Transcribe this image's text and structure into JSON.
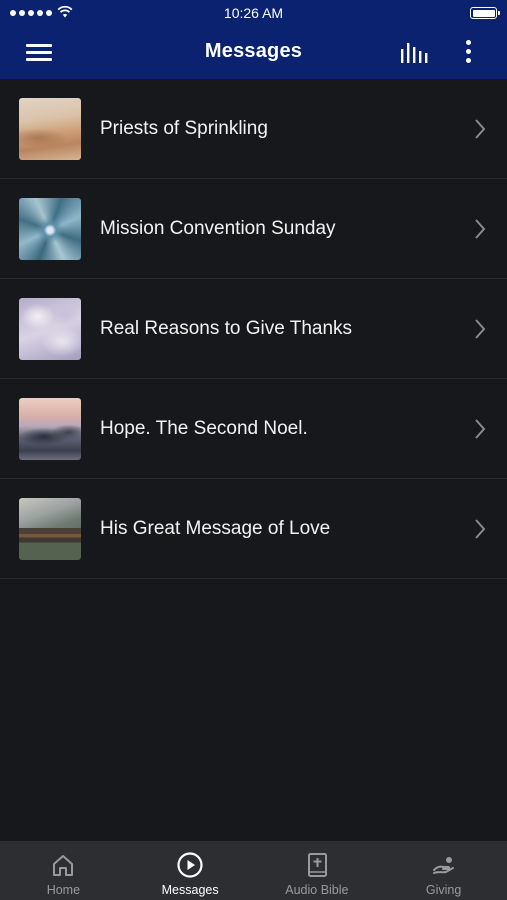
{
  "status_bar": {
    "time": "10:26 AM"
  },
  "header": {
    "title": "Messages"
  },
  "messages": [
    {
      "title": "Priests of Sprinkling",
      "thumb": "desert-dunes"
    },
    {
      "title": "Mission Convention Sunday",
      "thumb": "agave-plant"
    },
    {
      "title": "Real Reasons to Give Thanks",
      "thumb": "clouds"
    },
    {
      "title": "Hope. The Second Noel.",
      "thumb": "misty-mountains"
    },
    {
      "title": "His Great Message of Love",
      "thumb": "mountain-lake-cabin"
    }
  ],
  "tabs": [
    {
      "label": "Home",
      "icon": "home-icon",
      "active": false
    },
    {
      "label": "Messages",
      "icon": "play-circle-icon",
      "active": true
    },
    {
      "label": "Audio Bible",
      "icon": "bible-icon",
      "active": false
    },
    {
      "label": "Giving",
      "icon": "giving-hand-icon",
      "active": false
    }
  ],
  "colors": {
    "header_bg": "#0a2270",
    "list_bg": "#17181b",
    "tab_bar_bg": "#2d2e31",
    "tab_inactive": "#9a9a9e"
  }
}
